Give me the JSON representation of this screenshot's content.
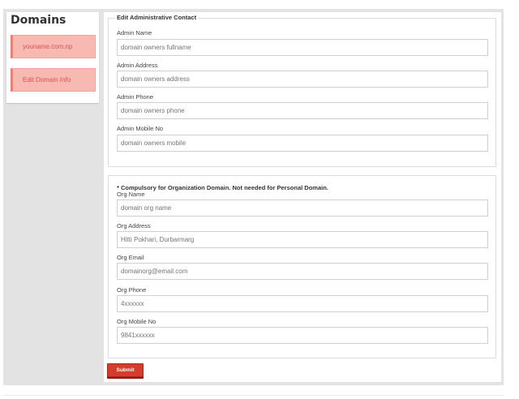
{
  "sidebar": {
    "title": "Domains",
    "items": [
      {
        "label": "youname.com.np"
      },
      {
        "label": "Edit Domain Info"
      }
    ]
  },
  "admin_contact": {
    "legend": "Edit Administrative Contact",
    "fields": [
      {
        "label": "Admin Name",
        "placeholder": "domain owners fullname"
      },
      {
        "label": "Admin Address",
        "placeholder": "domain owners address"
      },
      {
        "label": "Admin Phone",
        "placeholder": "domain owners phone"
      },
      {
        "label": "Admin Mobile No",
        "placeholder": "domain owners mobile"
      }
    ]
  },
  "org_contact": {
    "note": "* Compulsory for Organization Domain. Not needed for Personal Domain.",
    "fields": [
      {
        "label": "Org Name",
        "placeholder": "domain org name"
      },
      {
        "label": "Org Address",
        "placeholder": "Hitti Pokhari, Durbarmarg"
      },
      {
        "label": "Org Email",
        "placeholder": "domainorg@email.com"
      },
      {
        "label": "Org Phone",
        "placeholder": "4xxxxxx"
      },
      {
        "label": "Org Mobile No",
        "placeholder": "9841xxxxxx"
      }
    ]
  },
  "actions": {
    "submit_label": "Submit"
  }
}
